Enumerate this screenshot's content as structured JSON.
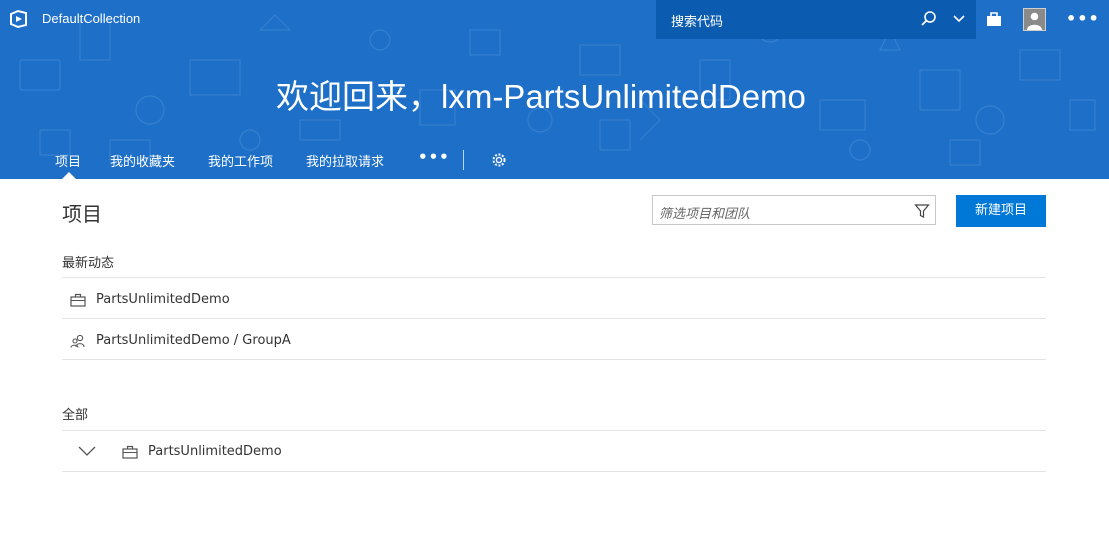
{
  "topbar": {
    "collection": "DefaultCollection",
    "search_placeholder": "搜索代码"
  },
  "hero": {
    "welcome": "欢迎回来，lxm-PartsUnlimitedDemo"
  },
  "nav": {
    "items": [
      "项目",
      "我的收藏夹",
      "我的工作项",
      "我的拉取请求"
    ],
    "active": "项目",
    "more": "•••"
  },
  "main": {
    "title": "项目",
    "filter_placeholder": "筛选项目和团队",
    "new_button": "新建项目",
    "recent": {
      "label": "最新动态",
      "items": [
        {
          "icon": "project-briefcase-icon",
          "text": "PartsUnlimitedDemo"
        },
        {
          "icon": "team-people-icon",
          "text": "PartsUnlimitedDemo / GroupA"
        }
      ]
    },
    "all": {
      "label": "全部",
      "items": [
        {
          "icon": "project-briefcase-icon",
          "text": "PartsUnlimitedDemo",
          "expanded": false
        }
      ]
    }
  },
  "colors": {
    "header_bg": "#1e6fc7",
    "search_bg": "#0b5cb0",
    "accent": "#0078d7"
  }
}
